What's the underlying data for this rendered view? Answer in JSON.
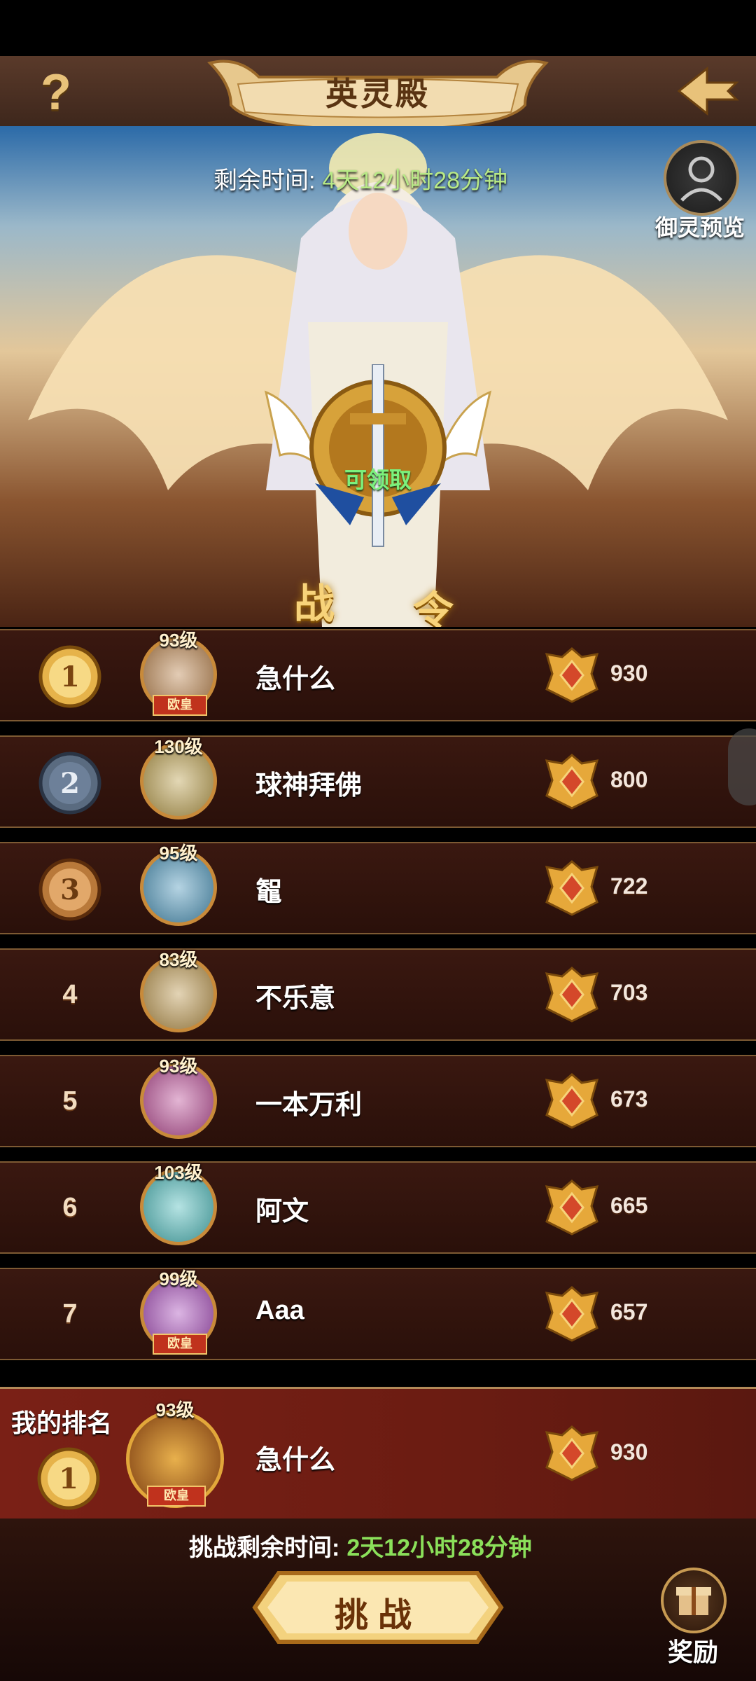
{
  "header": {
    "title": "英灵殿",
    "help_label": "?"
  },
  "hero": {
    "timer_label": "剩余时间:",
    "timer_value": "4天12小时28分钟",
    "preview_label": "御灵预览",
    "battle_pass_chars": [
      "战",
      "令"
    ],
    "claim_label": "可领取"
  },
  "leaderboard": [
    {
      "rank": "1",
      "level": "93级",
      "title": "欧皇",
      "name": "急什么",
      "score": "930"
    },
    {
      "rank": "2",
      "level": "130级",
      "title": "",
      "name": "球神拜佛",
      "score": "800"
    },
    {
      "rank": "3",
      "level": "95级",
      "title": "",
      "name": "鼅",
      "score": "722"
    },
    {
      "rank": "4",
      "level": "83级",
      "title": "",
      "name": "不乐意",
      "score": "703"
    },
    {
      "rank": "5",
      "level": "93级",
      "title": "",
      "name": "一本万利",
      "score": "673"
    },
    {
      "rank": "6",
      "level": "103级",
      "title": "",
      "name": "阿文",
      "score": "665"
    },
    {
      "rank": "7",
      "level": "99级",
      "title": "欧皇",
      "name": "Aaa",
      "score": "657"
    }
  ],
  "my_rank": {
    "label": "我的排名",
    "rank": "1",
    "level": "93级",
    "title": "欧皇",
    "name": "急什么",
    "score": "930"
  },
  "footer": {
    "challenge_timer_label": "挑战剩余时间:",
    "challenge_timer_value": "2天12小时28分钟",
    "challenge_label": "挑战",
    "reward_label": "奖励"
  },
  "colors": {
    "gold": "#e8c27a",
    "timer_green": "#b8e986",
    "row_bg": "#2a100a",
    "my_panel_bg": "#6b1c12"
  }
}
